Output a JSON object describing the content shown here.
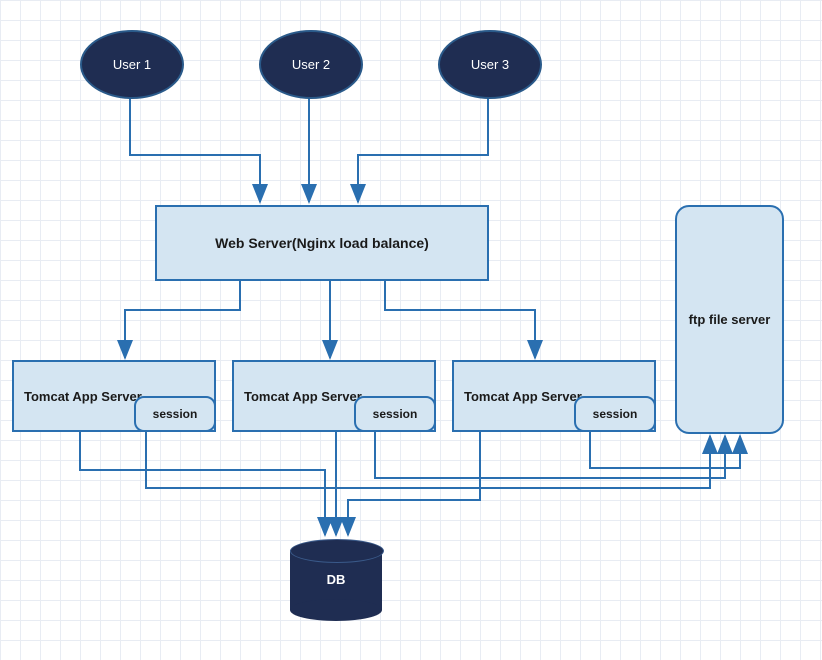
{
  "users": {
    "u1": "User 1",
    "u2": "User 2",
    "u3": "User 3"
  },
  "webServer": {
    "label": "Web Server(Nginx  load balance)"
  },
  "tomcat": {
    "label": "Tomcat App Server",
    "sessionLabel": "session"
  },
  "ftp": {
    "label": "ftp file server"
  },
  "db": {
    "label": "DB"
  },
  "colors": {
    "darkNavy": "#1f2d52",
    "lightBlue": "#d4e5f2",
    "borderBlue": "#2a6fb0",
    "arrowBlue": "#2a6fb0"
  }
}
